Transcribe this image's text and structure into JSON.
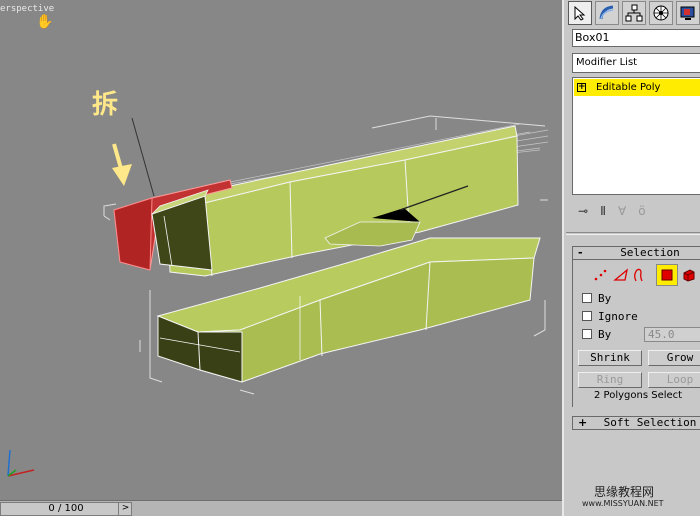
{
  "viewport": {
    "label": "erspective",
    "annotation": "拆"
  },
  "timeline": {
    "frame": "0 / 100",
    "arrow": ">"
  },
  "panel": {
    "object_name": "Box01",
    "modifier_list": "Modifier List",
    "stack_item": "Editable Poly",
    "stack_item_sign": "+",
    "selection": {
      "sign": "-",
      "title": "Selection",
      "by_vertex": "By",
      "ignore_backfacing": "Ignore",
      "by_angle": "By",
      "angle_value": "45.0",
      "shrink": "Shrink",
      "grow": "Grow",
      "ring": "Ring",
      "loop": "Loop",
      "status": "2 Polygons Select"
    },
    "soft_selection": {
      "sign": "+",
      "title": "Soft Selection"
    }
  },
  "watermark": {
    "line1": "思缘教程网",
    "line2": "www.MISSYUAN.NET"
  },
  "colors": {
    "viewport_bg": "#878787",
    "mesh_face": "#b4c65a",
    "mesh_dark": "#3c4216",
    "selected_face": "#c43030",
    "stack_highlight": "#ffec00",
    "annotation": "#ffe88a"
  }
}
